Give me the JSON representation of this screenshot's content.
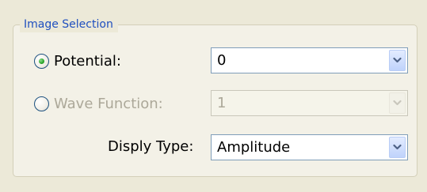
{
  "group": {
    "title": "Image Selection"
  },
  "potential": {
    "radio_label": "Potential:",
    "selected": true,
    "value": "0"
  },
  "wave_function": {
    "radio_label": "Wave Function:",
    "selected": false,
    "value": "1",
    "enabled": false
  },
  "display_type": {
    "label": "Disply Type:",
    "value": "Amplitude"
  },
  "colors": {
    "group_title": "#1f4fbf",
    "radio_checked_dot": "#2aa52a",
    "combo_border": "#7f9db9",
    "dropdown_arrow": "#4d6185",
    "disabled_text": "#aca899"
  },
  "icons": {
    "dropdown": "chevron-down-icon",
    "radio_selected": "radio-checked-icon",
    "radio_unselected": "radio-unchecked-icon"
  }
}
